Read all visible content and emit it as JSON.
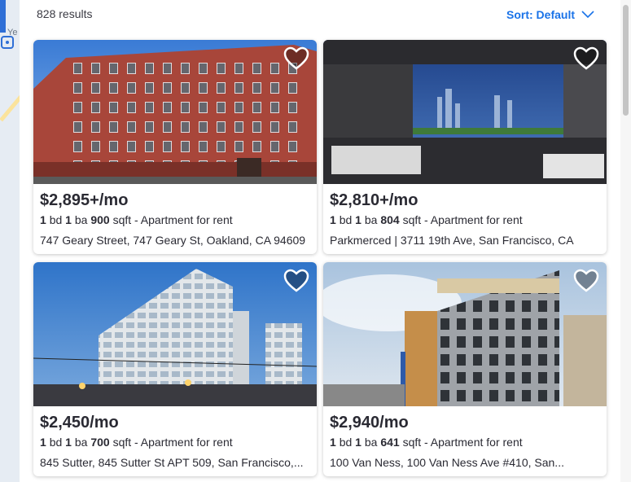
{
  "results_count": "828 results",
  "sort_label": "Sort: Default",
  "map": {
    "label_fragment": "Ye"
  },
  "listings": [
    {
      "price": "$2,895+/mo",
      "beds": "1",
      "beds_unit": "bd",
      "baths": "1",
      "baths_unit": "ba",
      "sqft": "900",
      "sqft_unit": "sqft",
      "type": "- Apartment for rent",
      "address": "747 Geary Street, 747 Geary St, Oakland, CA 94609",
      "favorite": false
    },
    {
      "price": "$2,810+/mo",
      "beds": "1",
      "beds_unit": "bd",
      "baths": "1",
      "baths_unit": "ba",
      "sqft": "804",
      "sqft_unit": "sqft",
      "type": "- Apartment for rent",
      "address": "Parkmerced | 3711 19th Ave, San Francisco, CA",
      "favorite": false
    },
    {
      "price": "$2,450/mo",
      "beds": "1",
      "beds_unit": "bd",
      "baths": "1",
      "baths_unit": "ba",
      "sqft": "700",
      "sqft_unit": "sqft",
      "type": "- Apartment for rent",
      "address": "845 Sutter, 845 Sutter St APT 509, San Francisco,...",
      "favorite": false
    },
    {
      "price": "$2,940/mo",
      "beds": "1",
      "beds_unit": "bd",
      "baths": "1",
      "baths_unit": "ba",
      "sqft": "641",
      "sqft_unit": "sqft",
      "type": "- Apartment for rent",
      "address": "100 Van Ness, 100 Van Ness Ave #410, San...",
      "favorite": false
    }
  ],
  "colors": {
    "accent": "#1a73e8",
    "text": "#2a2a33"
  }
}
